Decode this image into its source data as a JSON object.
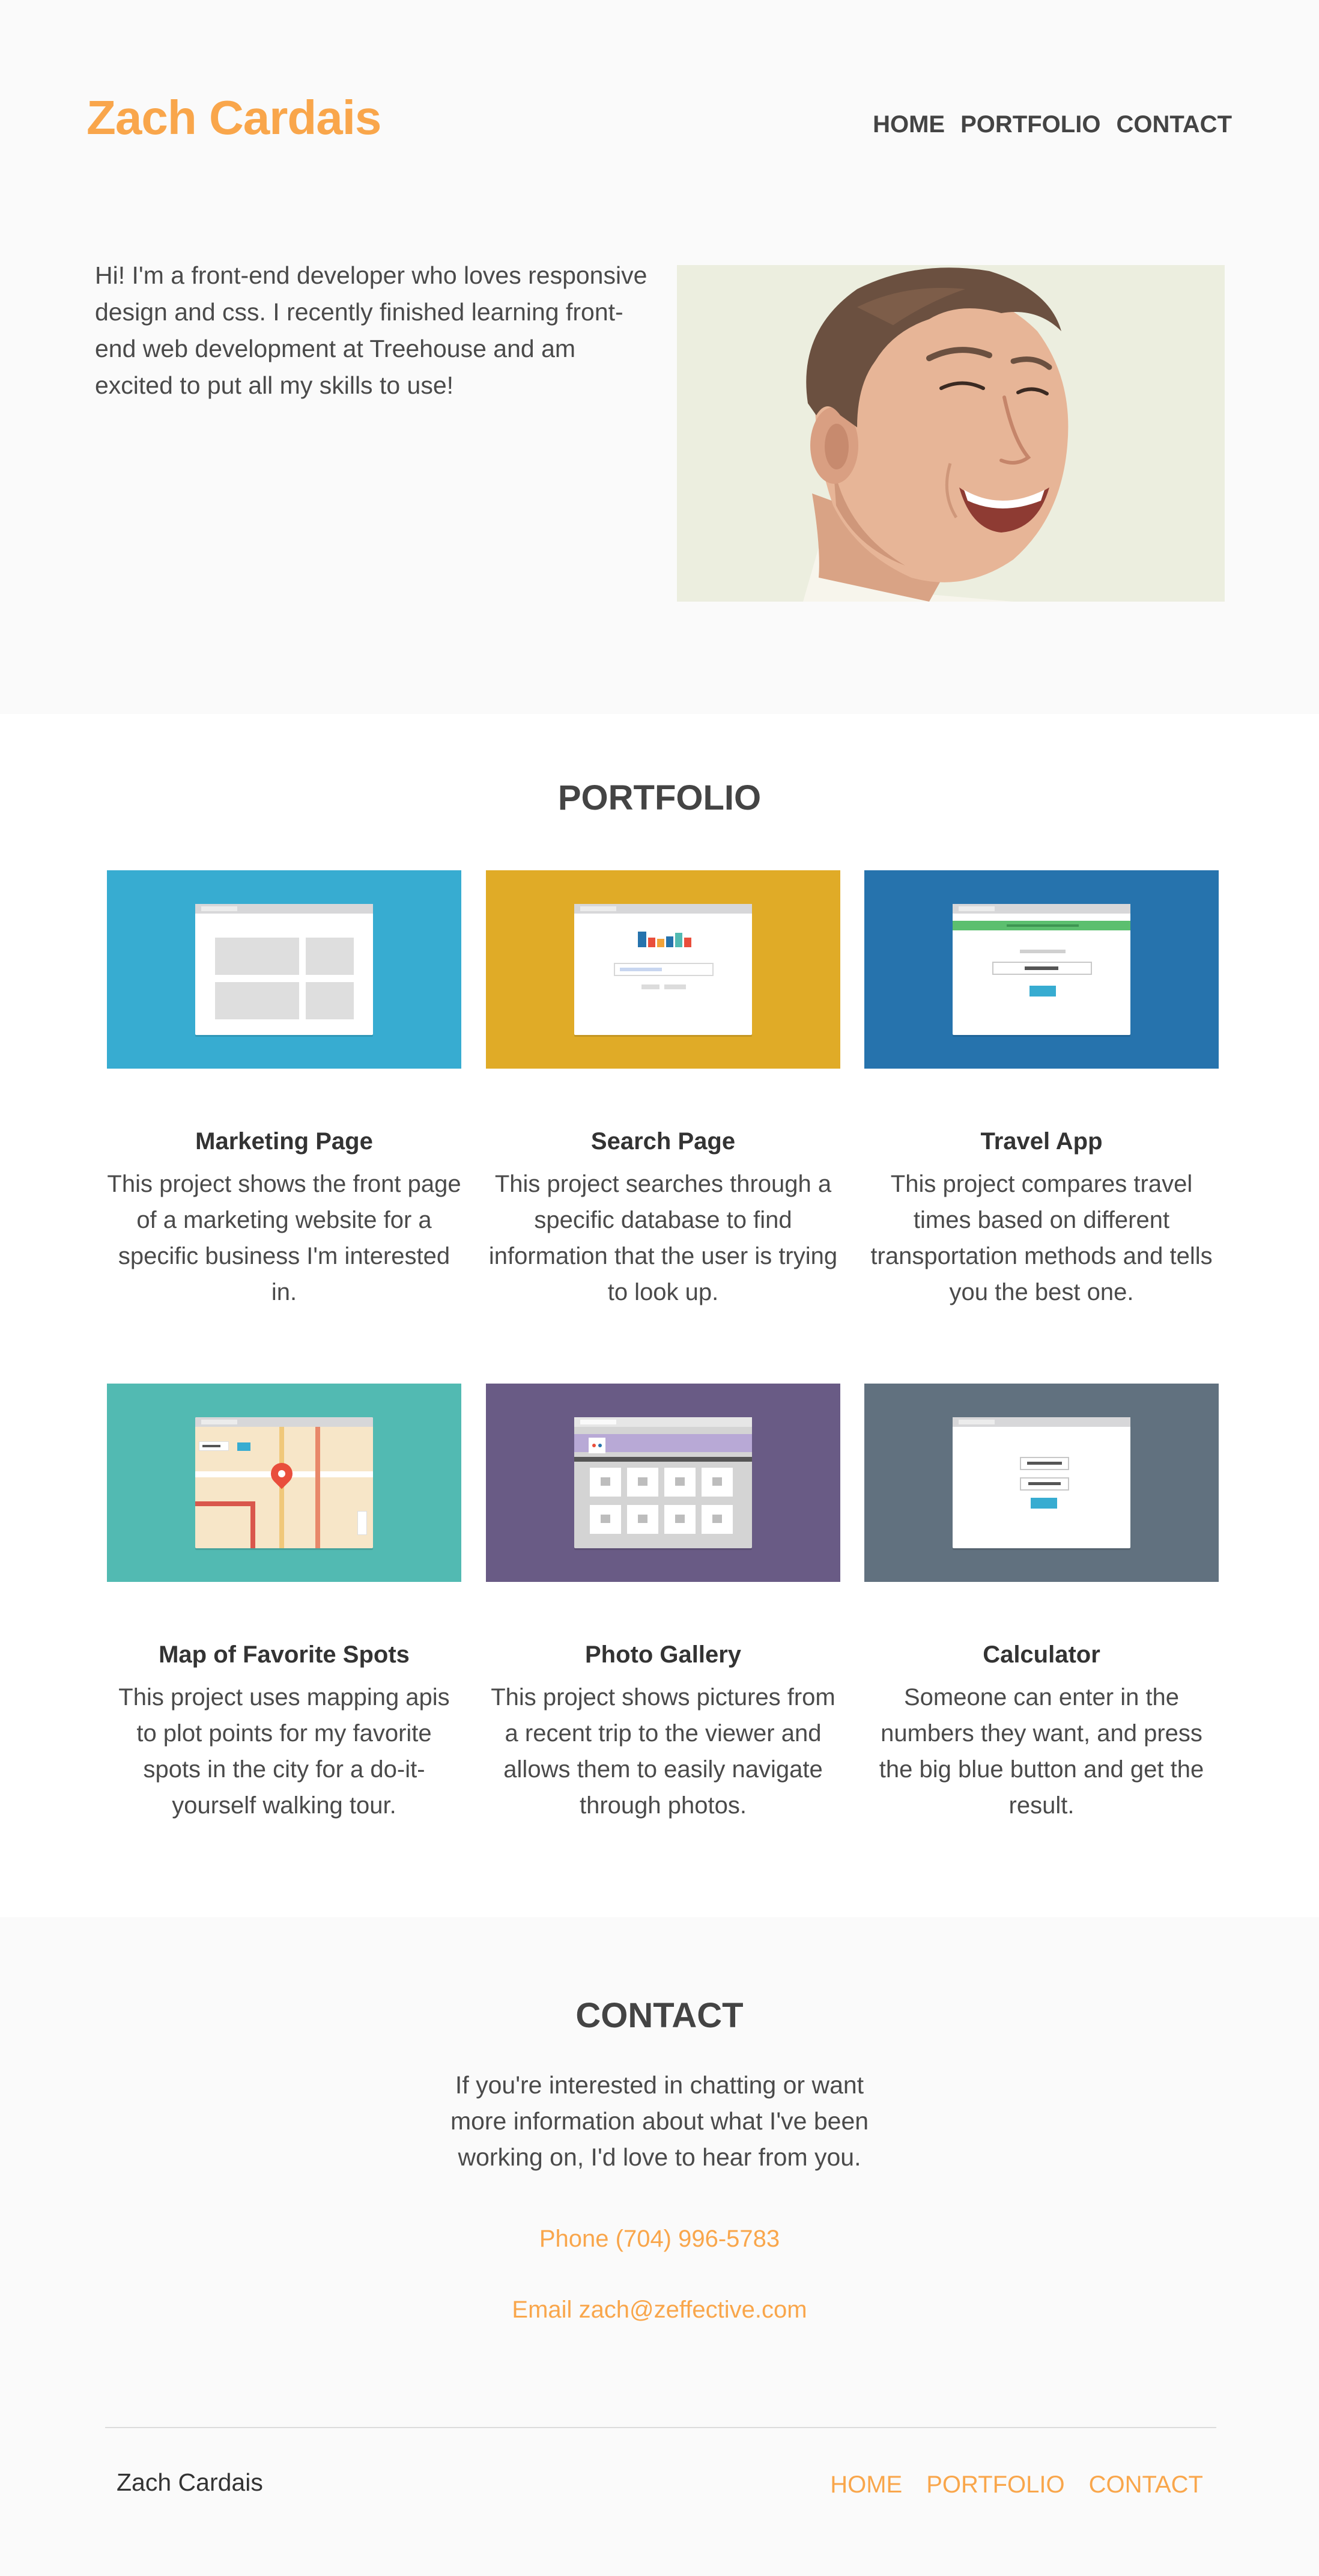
{
  "header": {
    "brand": "Zach Cardais",
    "nav": [
      "HOME",
      "PORTFOLIO",
      "CONTACT"
    ],
    "intro": "Hi! I'm a front-end developer who loves responsive design and css. I recently finished learning front-end web development at Treehouse and am excited to put all my skills to use!"
  },
  "portfolio": {
    "title": "PORTFOLIO",
    "projects": [
      {
        "title": "Marketing Page",
        "description": "This project shows the front page of a marketing website for a specific business I'm interested in.",
        "color": "#37acd1"
      },
      {
        "title": "Search Page",
        "description": "This project searches through a specific database to find information that the user is trying to look up.",
        "color": "#e0ab27"
      },
      {
        "title": "Travel App",
        "description": "This project compares travel times based on different transportation methods and tells you the best one.",
        "color": "#2673ad"
      },
      {
        "title": "Map of Favorite Spots",
        "description": "This project uses mapping apis to plot points for my favorite spots in the city for a do-it-yourself walking tour.",
        "color": "#52bab2"
      },
      {
        "title": "Photo Gallery",
        "description": "This project shows pictures from a recent trip to the viewer and allows them to easily navigate through photos.",
        "color": "#695b85"
      },
      {
        "title": "Calculator",
        "description": "Someone can enter in the numbers they want, and press the big blue button and get the result.",
        "color": "#61717f"
      }
    ]
  },
  "contact": {
    "title": "CONTACT",
    "text": "If you're interested in chatting or want more information about what I've been working on, I'd love to hear from you.",
    "phone_label": "Phone",
    "phone": "(704) 996-5783",
    "email_label": "Email",
    "email": "zach@zeffective.com"
  },
  "footer": {
    "name": "Zach Cardais",
    "nav": [
      "HOME",
      "PORTFOLIO",
      "CONTACT"
    ]
  },
  "colors": {
    "accent": "#f9a64b",
    "text": "#4a4a4a",
    "background": "#fafafa"
  }
}
